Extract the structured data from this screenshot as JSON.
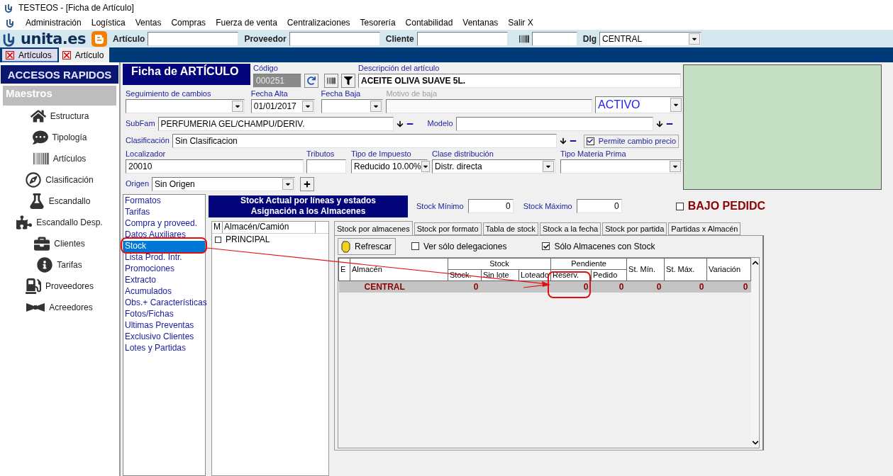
{
  "window": {
    "title": "TESTEOS - [Ficha de Artículo]"
  },
  "menu": [
    "Administración",
    "Logística",
    "Ventas",
    "Compras",
    "Fuerza de venta",
    "Centralizaciones",
    "Tesorería",
    "Contabilidad",
    "Ventanas",
    "Salir X"
  ],
  "toolbar": {
    "logo": "unita.es",
    "fields": [
      {
        "kind": "text",
        "label": "Artículo"
      },
      {
        "kind": "text",
        "label": "Proveedor"
      },
      {
        "kind": "text",
        "label": "Cliente"
      },
      {
        "kind": "barcode"
      },
      {
        "kind": "select",
        "label": "Dlg",
        "value": "CENTRAL"
      }
    ]
  },
  "doc_tabs": [
    {
      "label": "Artículos",
      "selected": false
    },
    {
      "label": "Artículo",
      "selected": true
    }
  ],
  "sidebar": {
    "title": "ACCESOS RAPIDOS",
    "section": "Maestros",
    "items": [
      "Estructura",
      "Tipología",
      "Artículos",
      "Clasificación",
      "Escandallo",
      "Escandallo Desp.",
      "Clientes",
      "Tarifas",
      "Proveedores",
      "Acreedores"
    ]
  },
  "form": {
    "title": "Ficha de ARTÍCULO",
    "codigo": {
      "label": "Código",
      "value": "000251"
    },
    "descripcion": {
      "label": "Descripción del artículo",
      "value": "ACEITE OLIVA SUAVE 5L."
    },
    "seguimiento": {
      "label": "Seguimiento de cambios"
    },
    "fecha_alta": {
      "label": "Fecha Alta",
      "value": "01/01/2017"
    },
    "fecha_baja": {
      "label": "Fecha Baja"
    },
    "motivo_baja": {
      "label": "Motivo de baja",
      "disabled": true
    },
    "estado": {
      "value": "ACTIVO"
    },
    "subfam": {
      "label": "SubFam",
      "value": "PERFUMERIA GEL/CHAMPU/DERIV."
    },
    "modelo": {
      "label": "Modelo"
    },
    "clasificacion": {
      "label": "Clasificación",
      "value": "Sin Clasificacion"
    },
    "permite_cambio_precio": {
      "label": "Permite cambio precio",
      "checked": true
    },
    "localizador": {
      "label": "Localizador",
      "value": "20010"
    },
    "tributos": {
      "label": "Tributos"
    },
    "tipo_impuesto": {
      "label": "Tipo de Impuesto",
      "value": "Reducido 10.00%"
    },
    "clase_distribucion": {
      "label": "Clase distribución",
      "value": "Distr. directa"
    },
    "tipo_materia_prima": {
      "label": "Tipo Materia Prima"
    },
    "origen": {
      "label": "Origen",
      "value": "Sin Origen"
    }
  },
  "sections": [
    {
      "label": "Formatos",
      "selected": false
    },
    {
      "label": "Tarifas",
      "selected": false
    },
    {
      "label": "Compra y proveed.",
      "selected": false
    },
    {
      "label": "Datos Auxiliares",
      "selected": false
    },
    {
      "label": "Stock",
      "selected": true
    },
    {
      "label": "Lista Prod. Intr.",
      "selected": false
    },
    {
      "label": "Promociones",
      "selected": false
    },
    {
      "label": "Extracto",
      "selected": false
    },
    {
      "label": "Acumulados",
      "selected": false
    },
    {
      "label": "Obs.+ Características",
      "selected": false
    },
    {
      "label": "Fotos/Fichas",
      "selected": false
    },
    {
      "label": "Ultimas Preventas",
      "selected": false
    },
    {
      "label": "Exclusivo Clientes",
      "selected": false
    },
    {
      "label": "Lotes y Partidas",
      "selected": false
    }
  ],
  "stock": {
    "title_lines": [
      "Stock Actual por líneas y estados",
      "Asignación a los Almacenes"
    ],
    "stock_minimo": {
      "label": "Stock Mínimo",
      "value": "0"
    },
    "stock_maximo": {
      "label": "Stock Máximo",
      "value": "0"
    },
    "bajo_pedido": {
      "label": "BAJO PEDIDC",
      "checked": false
    },
    "almacenes": {
      "columns": [
        "M",
        "Almacén/Camión"
      ],
      "rows": [
        {
          "name": "PRINCIPAL",
          "checked": false
        }
      ]
    },
    "tabs": [
      {
        "label": "Stock por almacenes",
        "selected": true
      },
      {
        "label": "Stock por formato",
        "selected": false
      },
      {
        "label": "Tabla de stock",
        "selected": false
      },
      {
        "label": "Stock a la fecha",
        "selected": false
      },
      {
        "label": "Stock por partida",
        "selected": false
      },
      {
        "label": "Partidas x Almacén",
        "selected": false
      }
    ],
    "refresh": "Refrescar",
    "filters": [
      {
        "label": "Ver sólo delegaciones",
        "checked": false
      },
      {
        "label": "Sólo Almacenes con Stock",
        "checked": true
      }
    ],
    "grid": {
      "leading": [
        "E",
        "Almacén"
      ],
      "groups": [
        {
          "label": "Stock",
          "columns": [
            "Stock.",
            "Sin lote",
            "Loteado"
          ]
        },
        {
          "label": "Pendiente",
          "columns": [
            "Reserv.",
            "Pedido"
          ]
        }
      ],
      "trailing": [
        "St. Mín.",
        "St. Máx.",
        "Variación"
      ],
      "rows": [
        {
          "almacen": "CENTRAL",
          "stock": "0",
          "reserv": "0",
          "pedido": "0",
          "st_min": "0",
          "st_max": "0",
          "variacion": "0"
        }
      ]
    }
  }
}
